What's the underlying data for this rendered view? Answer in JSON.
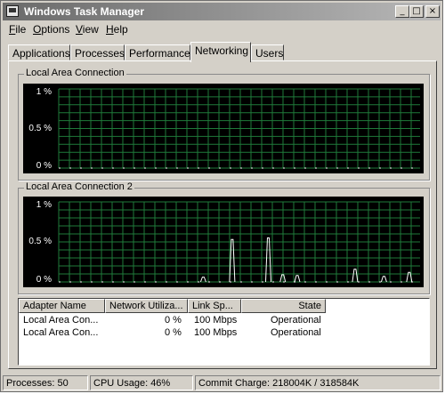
{
  "window": {
    "title": "Windows Task Manager"
  },
  "menu": [
    {
      "label": "File",
      "key": "F",
      "rest": "ile"
    },
    {
      "label": "Options",
      "key": "O",
      "rest": "ptions"
    },
    {
      "label": "View",
      "key": "V",
      "rest": "iew"
    },
    {
      "label": "Help",
      "key": "H",
      "rest": "elp"
    }
  ],
  "tabs": [
    "Applications",
    "Processes",
    "Performance",
    "Networking",
    "Users"
  ],
  "active_tab": "Networking",
  "graphs": [
    {
      "title": "Local Area Connection",
      "y_ticks": [
        "1 %",
        "0.5 %",
        "0 %"
      ],
      "activity": []
    },
    {
      "title": "Local Area Connection 2",
      "y_ticks": [
        "1 %",
        "0.5 %",
        "0 %"
      ],
      "activity": [
        {
          "t": 0.4,
          "v": 0.06
        },
        {
          "t": 0.48,
          "v": 0.53
        },
        {
          "t": 0.58,
          "v": 0.55
        },
        {
          "t": 0.62,
          "v": 0.09
        },
        {
          "t": 0.66,
          "v": 0.08
        },
        {
          "t": 0.82,
          "v": 0.16
        },
        {
          "t": 0.9,
          "v": 0.07
        },
        {
          "t": 0.97,
          "v": 0.12
        }
      ]
    }
  ],
  "adapter_table": {
    "columns": [
      "Adapter Name",
      "Network Utiliza...",
      "Link Sp...",
      "State"
    ],
    "rows": [
      {
        "name": "Local Area Con...",
        "utilization": "0 %",
        "speed": "100 Mbps",
        "state": "Operational"
      },
      {
        "name": "Local Area Con...",
        "utilization": "0 %",
        "speed": "100 Mbps",
        "state": "Operational"
      }
    ]
  },
  "status": {
    "processes": "Processes: 50",
    "cpu": "CPU Usage: 46%",
    "commit": "Commit Charge: 218004K / 318584K"
  },
  "colors": {
    "graph_bg": "#000000",
    "grid": "#1f7a3a",
    "trace": "#ffffff"
  }
}
